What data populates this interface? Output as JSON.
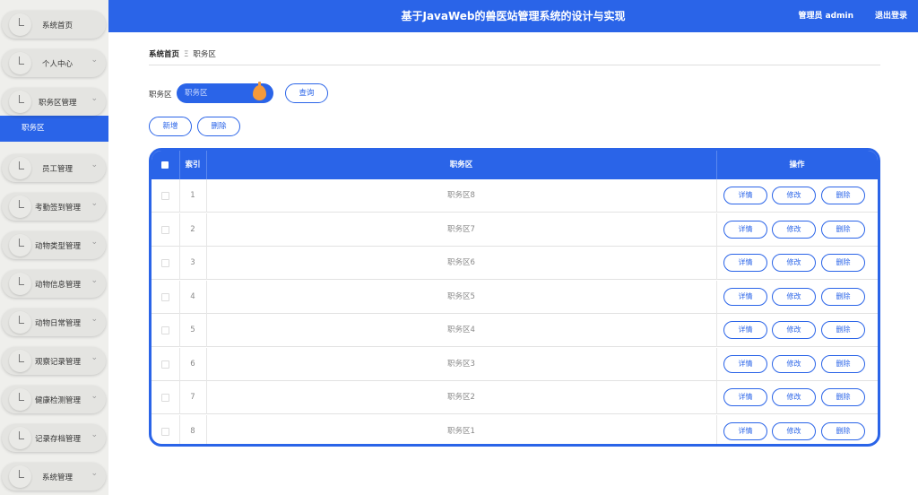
{
  "header": {
    "title": "基于JavaWeb的兽医站管理系统的设计与实现",
    "user": "管理员 admin",
    "logout": "退出登录"
  },
  "sidebar": {
    "items": [
      {
        "label": "系统首页",
        "chevron": false
      },
      {
        "label": "个人中心",
        "chevron": true
      },
      {
        "label": "职务区管理",
        "chevron": true
      },
      {
        "label": "员工管理",
        "chevron": true
      },
      {
        "label": "考勤签到管理",
        "chevron": true
      },
      {
        "label": "动物类型管理",
        "chevron": true
      },
      {
        "label": "动物信息管理",
        "chevron": true
      },
      {
        "label": "动物日常管理",
        "chevron": true
      },
      {
        "label": "观察记录管理",
        "chevron": true
      },
      {
        "label": "健康检测管理",
        "chevron": true
      },
      {
        "label": "记录存档管理",
        "chevron": true
      },
      {
        "label": "系统管理",
        "chevron": true
      }
    ],
    "active_sub": "职务区",
    "chevron_icon": "chevron-down-icon",
    "item_icon": "clock-icon"
  },
  "breadcrumb": {
    "home": "系统首页",
    "separator": "Ξ",
    "current": "职务区"
  },
  "search": {
    "label": "职务区",
    "placeholder": "职务区",
    "button": "查询"
  },
  "actions": {
    "add": "新增",
    "delete": "删除"
  },
  "table": {
    "columns": [
      "索引",
      "职务区",
      "操作"
    ],
    "rows": [
      {
        "index": "1",
        "name": "职务区8"
      },
      {
        "index": "2",
        "name": "职务区7"
      },
      {
        "index": "3",
        "name": "职务区6"
      },
      {
        "index": "4",
        "name": "职务区5"
      },
      {
        "index": "5",
        "name": "职务区4"
      },
      {
        "index": "6",
        "name": "职务区3"
      },
      {
        "index": "7",
        "name": "职务区2"
      },
      {
        "index": "8",
        "name": "职务区1"
      }
    ],
    "row_actions": {
      "detail": "详情",
      "edit": "修改",
      "delete": "删除"
    }
  },
  "colors": {
    "primary": "#2a64e8",
    "knob": "#f59a3a",
    "sidebar_bg": "#efefec"
  }
}
